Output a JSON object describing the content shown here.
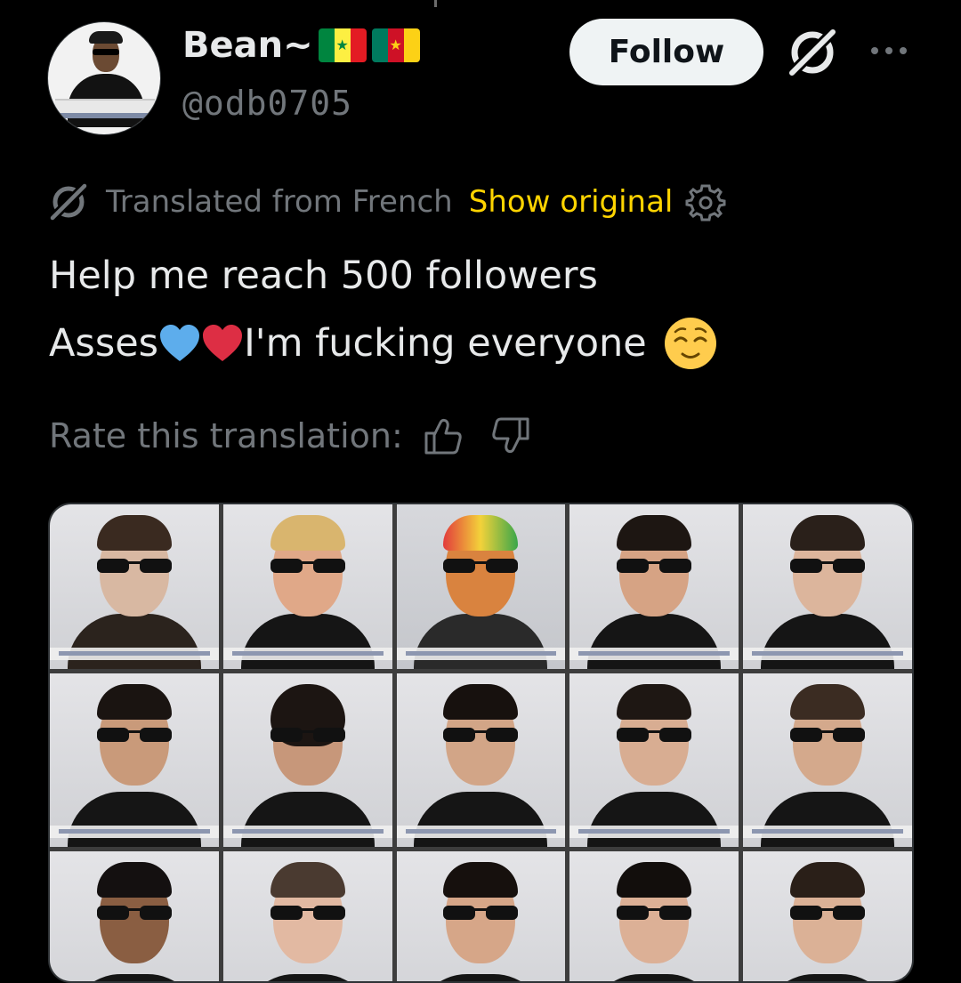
{
  "user": {
    "display_name": "Bean~",
    "handle": "@odb0705",
    "flags": [
      "senegal-flag",
      "cameroon-flag"
    ]
  },
  "actions": {
    "follow_label": "Follow",
    "grok_icon": "grok-icon",
    "more_icon": "more-options-icon"
  },
  "translation": {
    "from_label": "Translated from French",
    "show_original_label": "Show original",
    "settings_icon": "settings-icon"
  },
  "tweet": {
    "line1": "Help me reach 500 followers",
    "line2_prefix": "Asses",
    "line2_main": " I'm fucking everyone",
    "emojis": [
      "blue-heart",
      "red-heart",
      "relieved-face"
    ]
  },
  "rating": {
    "label": "Rate this translation:",
    "up_icon": "thumbs-up-icon",
    "down_icon": "thumbs-down-icon"
  },
  "colors": {
    "background": "#000000",
    "text": "#e7e9ea",
    "muted": "#71767b",
    "show_original": "#ffd400",
    "follow_bg": "#eff3f4"
  },
  "media": {
    "description_type": "photo-grid",
    "tiles": 15
  }
}
